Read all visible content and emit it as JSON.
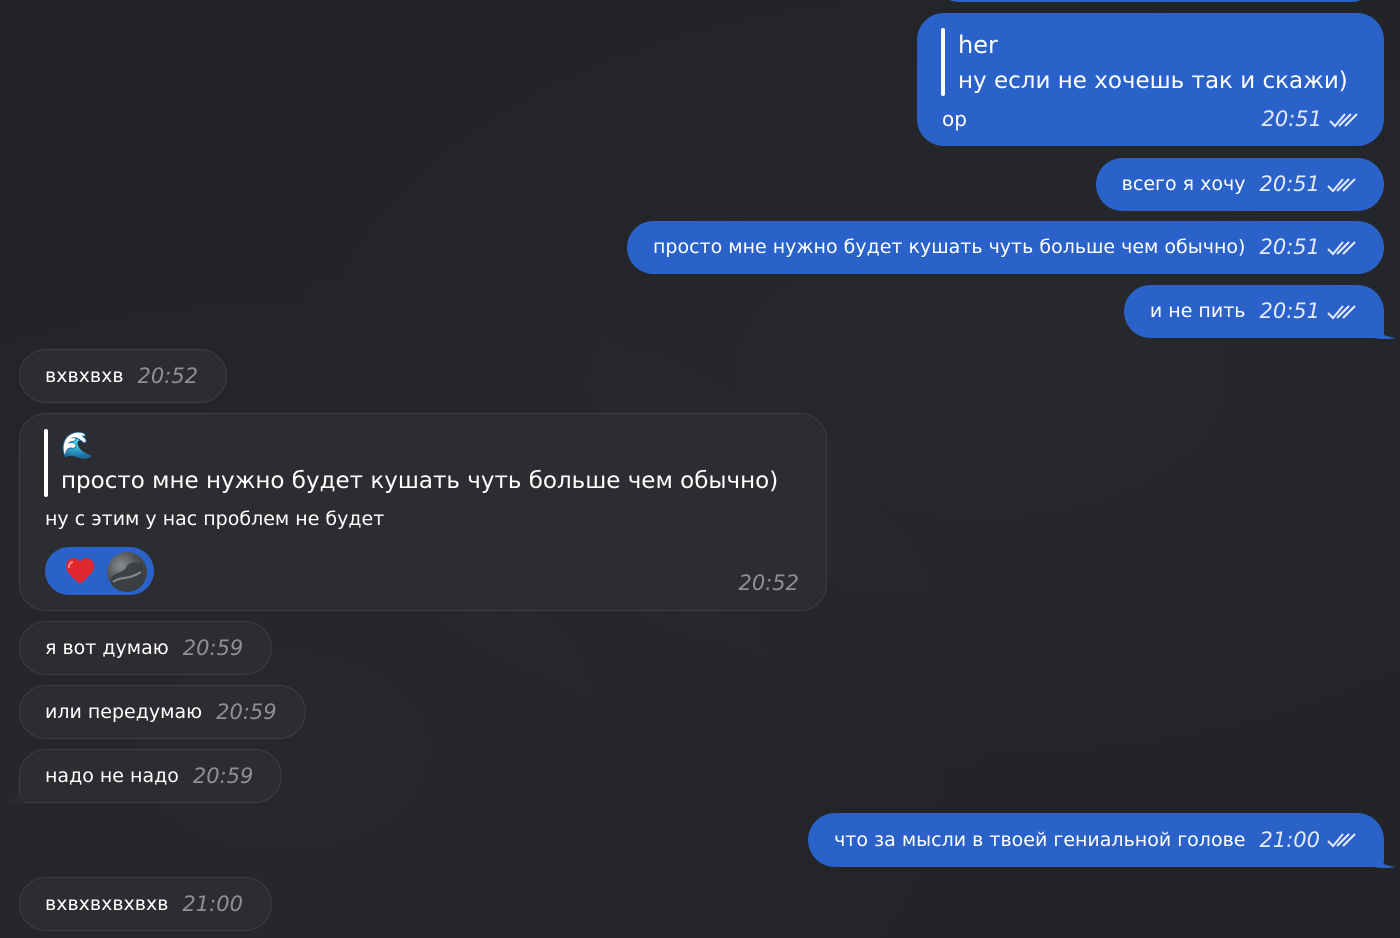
{
  "messages": [
    {
      "direction": "outgoing",
      "reply": {
        "author": "her",
        "text": "ну если не хочешь так и скажи)"
      },
      "text": "ор",
      "time": "20:51",
      "read": true
    },
    {
      "direction": "outgoing",
      "text": "всего я хочу",
      "time": "20:51",
      "read": true
    },
    {
      "direction": "outgoing",
      "text": "просто мне нужно будет кушать чуть больше чем обычно)",
      "time": "20:51",
      "read": true
    },
    {
      "direction": "outgoing",
      "text": "и не пить",
      "time": "20:51",
      "read": true
    },
    {
      "direction": "incoming",
      "text": "вхвхвхв",
      "time": "20:52"
    },
    {
      "direction": "incoming",
      "reply": {
        "author_emoji": "🌊",
        "text": "просто мне нужно будет кушать чуть больше чем обычно)"
      },
      "text": "ну с этим у нас проблем не будет",
      "time": "20:52",
      "reaction": {
        "emoji": "❤️",
        "icon": "heart-icon"
      }
    },
    {
      "direction": "incoming",
      "text": "я вот думаю",
      "time": "20:59"
    },
    {
      "direction": "incoming",
      "text": "или передумаю",
      "time": "20:59"
    },
    {
      "direction": "incoming",
      "text": "надо не надо",
      "time": "20:59"
    },
    {
      "direction": "outgoing",
      "text": "что за мысли в твоей гениальной голове",
      "time": "21:00",
      "read": true
    },
    {
      "direction": "incoming",
      "text": "вхвхвхвхвхв",
      "time": "21:00"
    }
  ],
  "theme": {
    "background": "#222428",
    "outgoing_bubble": "#2a62c9",
    "incoming_bubble": "#2c2d30",
    "reaction_pill": "#2a62c9",
    "heart": "#e0262f"
  },
  "icons": [
    "double-check-icon",
    "heart-icon",
    "avatar",
    "wave-emoji-icon"
  ]
}
